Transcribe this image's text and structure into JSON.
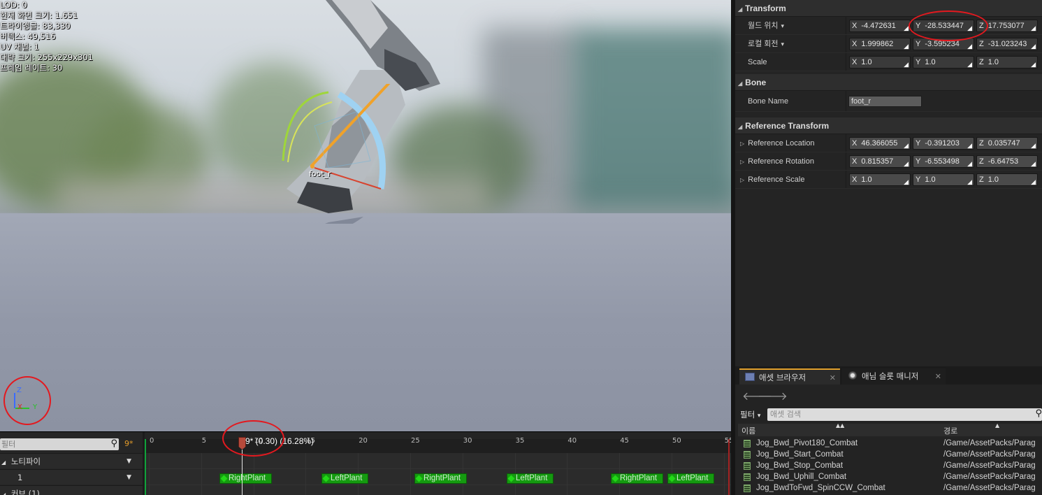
{
  "viewport": {
    "stats": [
      "LOD: 0",
      "현재 화면 크기: 1.651",
      "트라이앵글: 83,330",
      "버텍스: 49,516",
      "UV 채널: 1",
      "대략 크기: 255x229x301",
      "프레임 레이트: 30"
    ],
    "bone_label": "foot_r",
    "gizmo_axes": {
      "z": "Z",
      "x": "X",
      "y": "Y"
    },
    "colors": {
      "axis_z": "#3b6bff",
      "axis_x": "#e02020",
      "axis_y": "#29c229",
      "annotation": "#e3191f"
    }
  },
  "details": {
    "transform": {
      "title": "Transform",
      "rows": [
        {
          "label": "월드 위치",
          "x": "-4.472631",
          "y": "-28.533447",
          "z": "17.753077"
        },
        {
          "label": "로컬 회전",
          "x": "1.999862",
          "y": "-3.595234",
          "z": "-31.023243"
        },
        {
          "label": "Scale",
          "x": "1.0",
          "y": "1.0",
          "z": "1.0"
        }
      ]
    },
    "bone": {
      "title": "Bone",
      "label": "Bone Name",
      "value": "foot_r"
    },
    "reference": {
      "title": "Reference Transform",
      "rows": [
        {
          "label": "Reference Location",
          "x": "46.366055",
          "y": "-0.391203",
          "z": "0.035747"
        },
        {
          "label": "Reference Rotation",
          "x": "0.815357",
          "y": "-6.553498",
          "z": "-6.64753"
        },
        {
          "label": "Reference Scale",
          "x": "1.0",
          "y": "1.0",
          "z": "1.0"
        }
      ]
    },
    "axis_letters": {
      "x": "X",
      "y": "Y",
      "z": "Z"
    }
  },
  "asset_browser": {
    "tabs": [
      {
        "label": "애셋 브라우저",
        "icon": "asset-browser-icon",
        "active": true
      },
      {
        "label": "애님 슬롯 매니저",
        "icon": "anim-slot-manager-icon",
        "active": false
      }
    ],
    "filter_label": "필터",
    "search_placeholder": "애셋 검색",
    "columns": {
      "name": "이름",
      "path": "경로"
    },
    "assets": [
      {
        "name": "Jog_Bwd_Pivot180_Combat",
        "path": "/Game/AssetPacks/Parag"
      },
      {
        "name": "Jog_Bwd_Start_Combat",
        "path": "/Game/AssetPacks/Parag"
      },
      {
        "name": "Jog_Bwd_Stop_Combat",
        "path": "/Game/AssetPacks/Parag"
      },
      {
        "name": "Jog_Bwd_Uphill_Combat",
        "path": "/Game/AssetPacks/Parag"
      },
      {
        "name": "Jog_BwdToFwd_SpinCCW_Combat",
        "path": "/Game/AssetPacks/Parag"
      }
    ]
  },
  "timeline": {
    "filter_placeholder": "필터",
    "current_frame": "9*",
    "scrub_text": "9* (0.30) (16.28%)",
    "tracks": [
      {
        "label": "노티파이"
      },
      {
        "label": "1"
      },
      {
        "label": "커브 (1)"
      }
    ],
    "ticks": [
      "0",
      "5",
      "10",
      "15",
      "20",
      "25",
      "30",
      "35",
      "40",
      "45",
      "50",
      "55"
    ],
    "notifies": [
      "RightPlant",
      "LeftPlant",
      "RightPlant",
      "LeftPlant",
      "RightPlant",
      "LeftPlant"
    ]
  }
}
